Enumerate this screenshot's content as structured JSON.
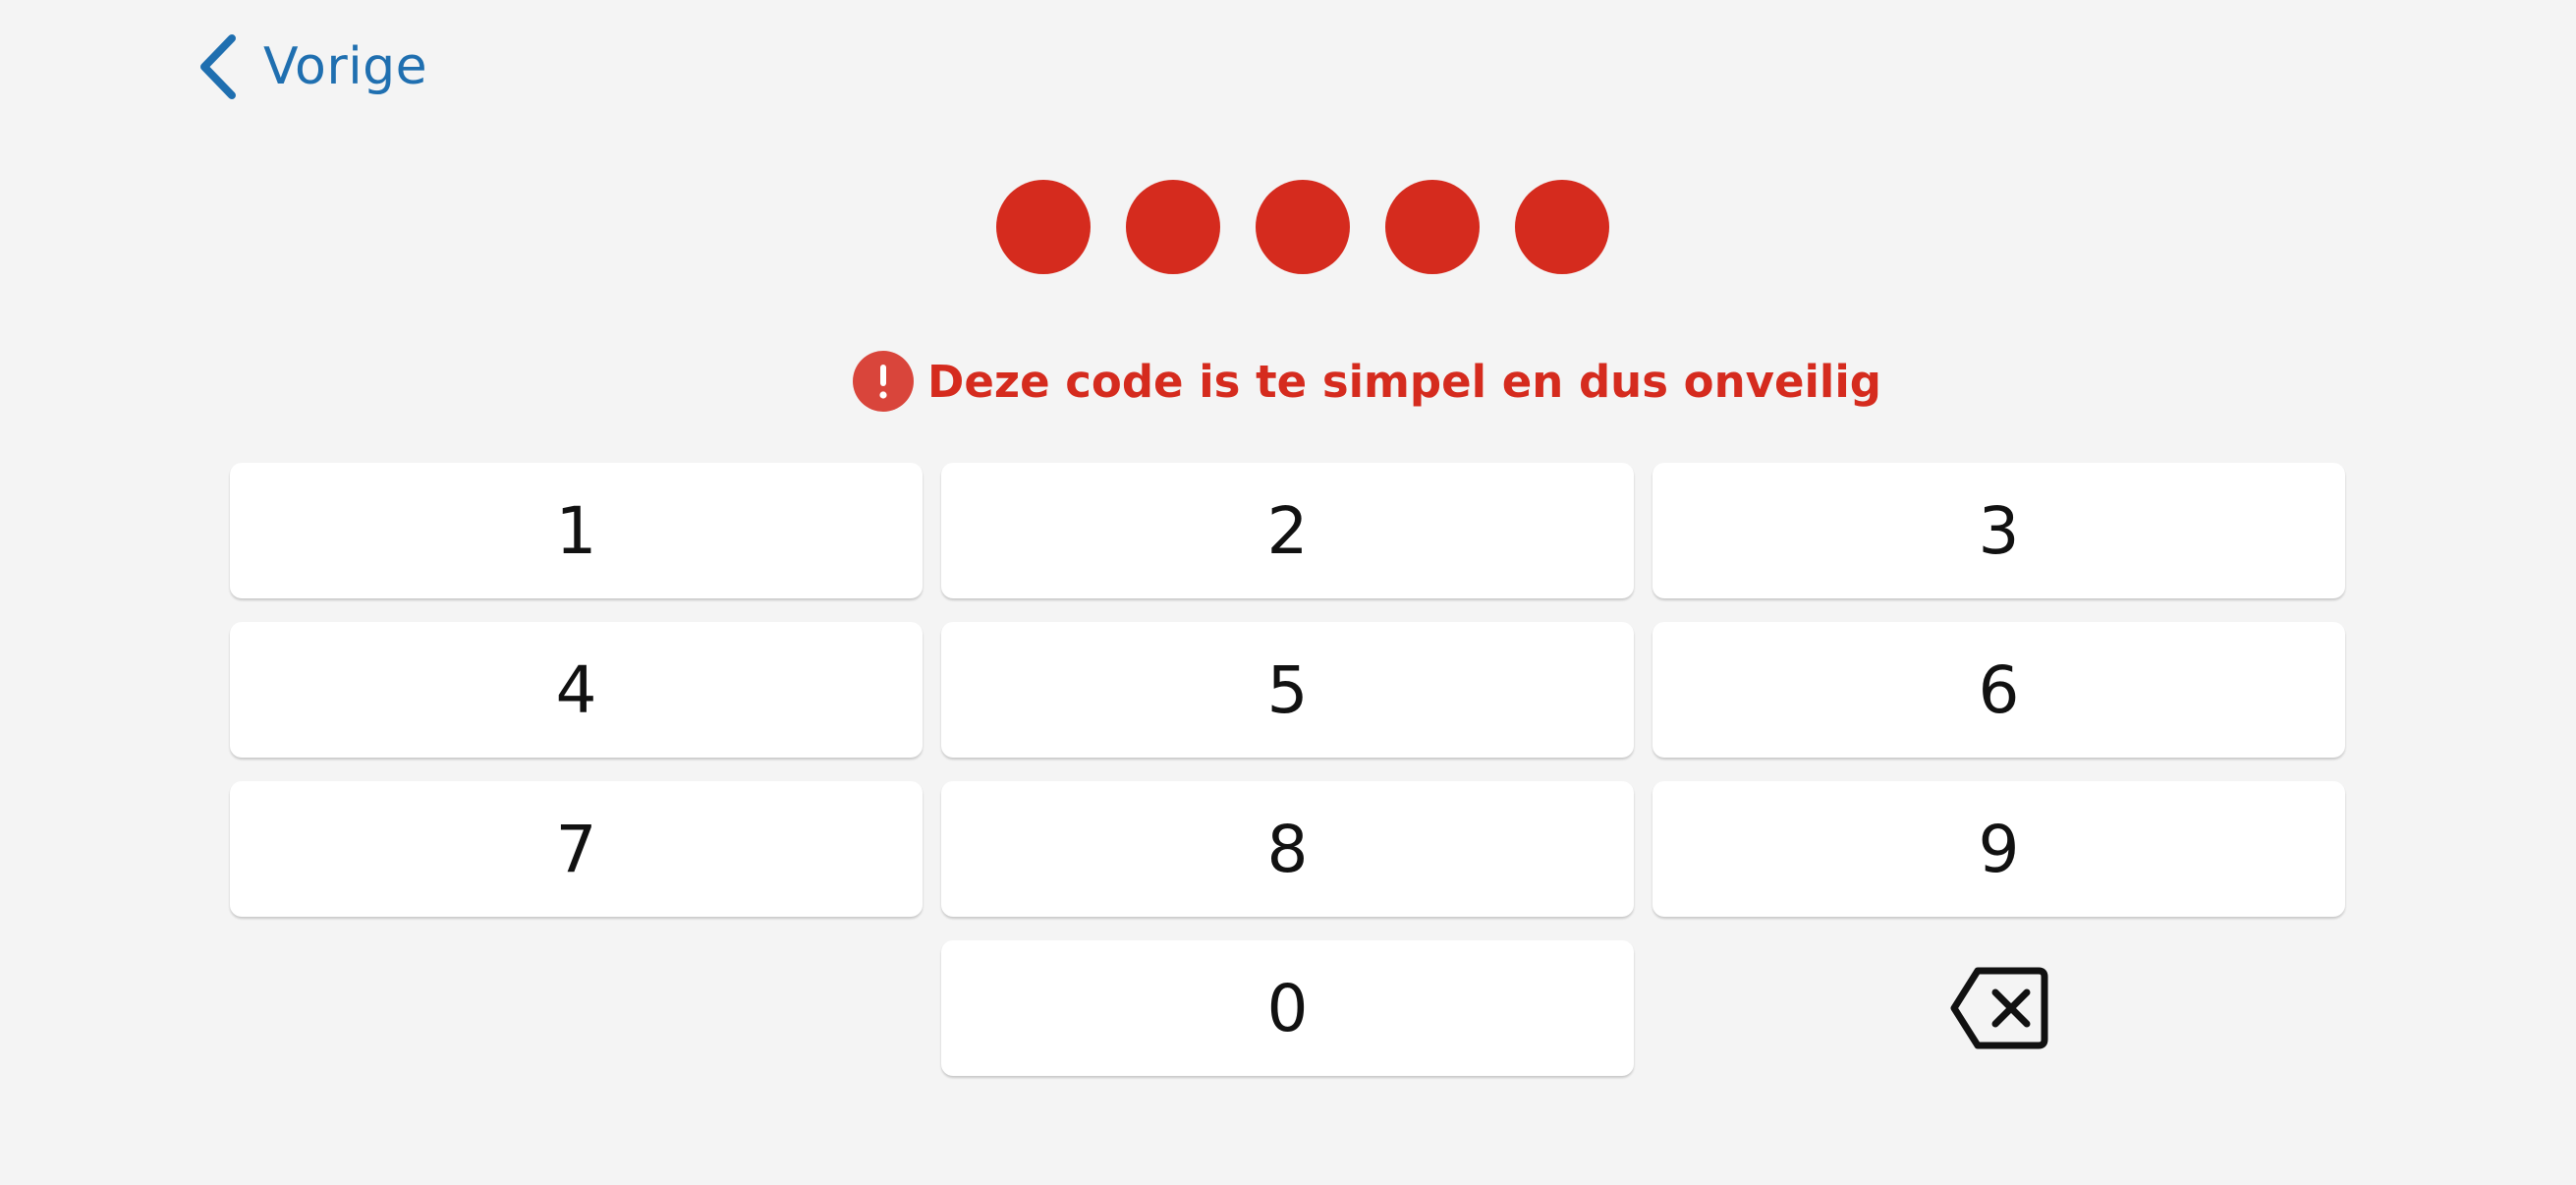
{
  "header": {
    "back_label": "Vorige",
    "back_icon": "chevron-left-icon"
  },
  "pin": {
    "length": 5,
    "filled": 5,
    "dot_color": "#d52b1e"
  },
  "error": {
    "icon": "exclamation-icon",
    "message": "Deze code is te simpel en dus onveilig",
    "color": "#d52b1e",
    "icon_color": "#d9453b"
  },
  "keypad": {
    "keys": [
      "1",
      "2",
      "3",
      "4",
      "5",
      "6",
      "7",
      "8",
      "9",
      "",
      "0",
      "backspace"
    ],
    "backspace_icon": "backspace-icon"
  },
  "colors": {
    "accent": "#1f6fb0",
    "background": "#f4f4f4",
    "key_background": "#ffffff"
  }
}
